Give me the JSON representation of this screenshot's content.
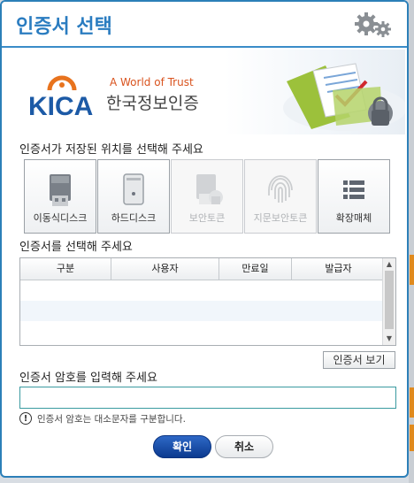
{
  "dialog": {
    "title": "인증서 선택",
    "settings_icon": "gear-icon"
  },
  "banner": {
    "brand_short": "KICA",
    "tagline": "A World of Trust",
    "brand_name": "한국정보인증",
    "illustration_icon": "certificate-folder-lock-icon"
  },
  "storage": {
    "heading": "인증서가 저장된 위치를 선택해 주세요",
    "locations": [
      {
        "label": "이동식디스크",
        "icon": "usb-drive-icon",
        "enabled": true
      },
      {
        "label": "하드디스크",
        "icon": "hard-disk-icon",
        "enabled": true
      },
      {
        "label": "보안토큰",
        "icon": "security-token-icon",
        "enabled": false
      },
      {
        "label": "지문보안토큰",
        "icon": "fingerprint-icon",
        "enabled": false
      },
      {
        "label": "확장매체",
        "icon": "list-icon",
        "enabled": true
      }
    ]
  },
  "certificates": {
    "heading": "인증서를 선택해 주세요",
    "columns": [
      "구분",
      "사용자",
      "만료일",
      "발급자"
    ],
    "rows": [],
    "view_button": "인증서 보기"
  },
  "password": {
    "heading": "인증서 암호를 입력해 주세요",
    "value": "",
    "notice": "인증서 암호는 대소문자를 구분합니다.",
    "notice_icon": "exclamation-circle-icon"
  },
  "actions": {
    "ok": "확인",
    "cancel": "취소"
  },
  "colors": {
    "accent": "#2a7cc0",
    "primary_button": "#0b3a8f",
    "brand_orange": "#e8731e",
    "brand_blue": "#1c5aa6"
  }
}
